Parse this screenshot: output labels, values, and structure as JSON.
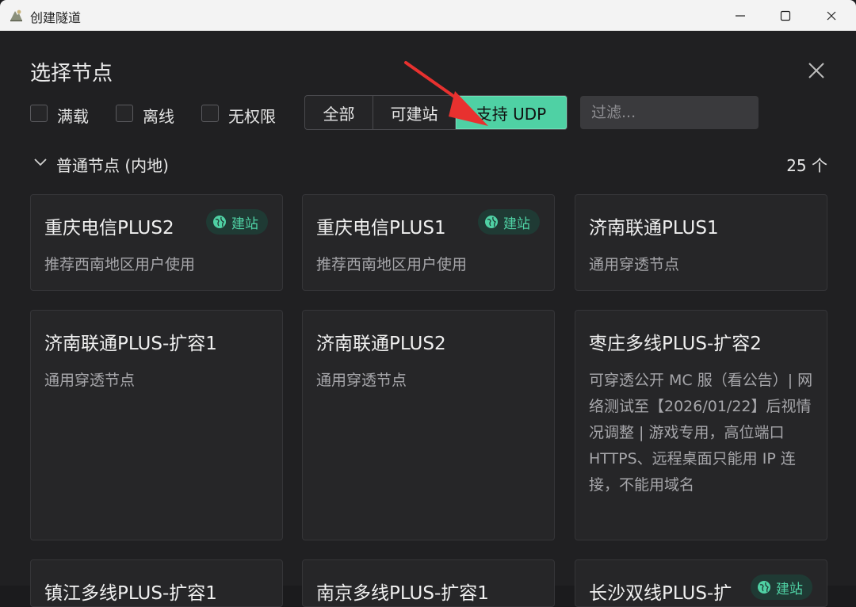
{
  "window": {
    "title": "创建隧道"
  },
  "dialog": {
    "title": "选择节点",
    "checkboxes": {
      "full": "满载",
      "offline": "离线",
      "no_permission": "无权限"
    },
    "segments": {
      "all": "全部",
      "site": "可建站",
      "udp": "支持 UDP"
    },
    "filter_placeholder": "过滤...",
    "group": {
      "title": "普通节点 (内地)",
      "count": "25 个"
    },
    "badge_label": "建站",
    "cards": [
      {
        "name": "重庆电信PLUS2",
        "desc": "推荐西南地区用户使用",
        "badge": true
      },
      {
        "name": "重庆电信PLUS1",
        "desc": "推荐西南地区用户使用",
        "badge": true
      },
      {
        "name": "济南联通PLUS1",
        "desc": "通用穿透节点",
        "badge": false
      },
      {
        "name": "济南联通PLUS-扩容1",
        "desc": "通用穿透节点",
        "badge": false
      },
      {
        "name": "济南联通PLUS2",
        "desc": "通用穿透节点",
        "badge": false
      },
      {
        "name": "枣庄多线PLUS-扩容2",
        "desc": "可穿透公开 MC 服（看公告）| 网络测试至【2026/01/22】后视情况调整 | 游戏专用，高位端口 HTTPS、远程桌面只能用 IP 连接，不能用域名",
        "badge": false
      }
    ],
    "partial_cards": [
      {
        "name": "镇江多线PLUS-扩容1"
      },
      {
        "name": "南京多线PLUS-扩容1"
      },
      {
        "name": "长沙双线PLUS-扩"
      }
    ]
  },
  "colors": {
    "accent": "#4fd1a4",
    "background": "#202022",
    "card": "#262628"
  }
}
